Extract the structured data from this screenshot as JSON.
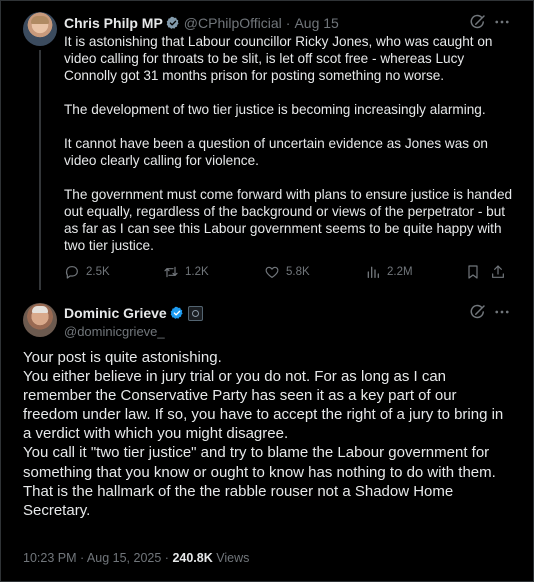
{
  "parent_tweet": {
    "author_name": "Chris Philp MP",
    "handle": "@CPhilpOfficial",
    "separator": "·",
    "date": "Aug 15",
    "paragraphs": [
      "It is astonishing that Labour councillor Ricky Jones, who was caught on video calling for throats to be slit, is let off scot free - whereas Lucy Connolly got 31 months prison for posting something no worse.",
      "The development of two tier justice is becoming increasingly alarming.",
      "It cannot have been a question of uncertain evidence as Jones was on video clearly calling for violence.",
      "The government must come forward with plans to ensure justice is handed out equally, regardless of the background or views of the perpetrator - but as far as I can see this Labour government seems to be quite happy with two tier justice."
    ],
    "stats": {
      "replies": "2.5K",
      "reposts": "1.2K",
      "likes": "5.8K",
      "views": "2.2M"
    }
  },
  "reply_tweet": {
    "author_name": "Dominic Grieve",
    "handle": "@dominicgrieve_",
    "lines": [
      "Your post is quite astonishing.",
      "You either believe in jury trial or you do not. For as long as I can remember the Conservative Party has seen it as a key part of our freedom under law. If so, you have to accept the right of a jury to bring in a verdict with which you might disagree.",
      "You call it \"two tier justice\" and try to blame the Labour government for something that you know or ought to know has nothing to do with them. That is the hallmark of the the rabble rouser not a Shadow Home Secretary."
    ],
    "timestamp": "10:23 PM · Aug 15, 2025",
    "meta_separator": "·",
    "views_count": "240.8K",
    "views_label": "Views"
  },
  "colors": {
    "background": "#000000",
    "text": "#e7e9ea",
    "secondary": "#71767b",
    "verified_blue": "#1d9bf0",
    "divider": "#2f3336"
  }
}
